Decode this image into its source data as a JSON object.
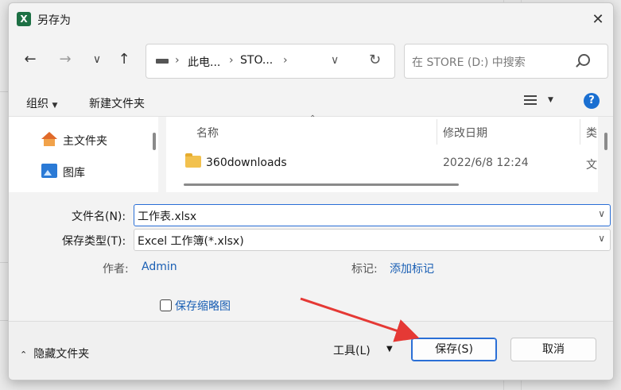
{
  "window": {
    "title": "另存为",
    "app_icon_letter": "X"
  },
  "nav": {
    "breadcrumb": [
      "此电...",
      "STO..."
    ],
    "search_placeholder": "在 STORE (D:) 中搜索"
  },
  "toolbar": {
    "organize": "组织",
    "new_folder": "新建文件夹"
  },
  "nav_pane": {
    "items": [
      "主文件夹",
      "图库"
    ]
  },
  "file_list": {
    "columns": [
      "名称",
      "修改日期",
      "类"
    ],
    "rows": [
      {
        "name": "360downloads",
        "date": "2022/6/8 12:24",
        "type": "文"
      }
    ]
  },
  "form": {
    "filename_label": "文件名(N):",
    "filename_value": "工作表.xlsx",
    "filetype_label": "保存类型(T):",
    "filetype_value": "Excel 工作簿(*.xlsx)",
    "author_label": "作者:",
    "author_value": "Admin",
    "tags_label": "标记:",
    "tags_value": "添加标记",
    "thumbnail_label": "保存缩略图"
  },
  "footer": {
    "hide_folders": "隐藏文件夹",
    "tools": "工具(L)",
    "save": "保存(S)",
    "cancel": "取消"
  },
  "colors": {
    "accent": "#2a6fd6",
    "link": "#1a5fb4",
    "annotation_arrow": "#e53935"
  }
}
